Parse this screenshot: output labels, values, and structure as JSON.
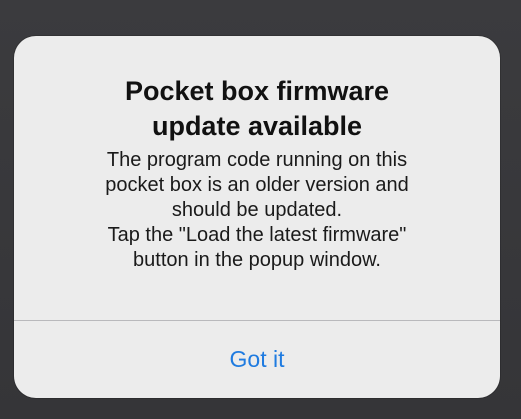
{
  "alert": {
    "title_line1": "Pocket box firmware",
    "title_line2": "update available",
    "message_lines": [
      "The program code running on this",
      "pocket box is an older version and",
      "should be updated.",
      "Tap the \"Load the latest firmware\"",
      "button in the popup window."
    ],
    "action_label": "Got it"
  },
  "colors": {
    "backdrop": "#3a3a3c",
    "alert_background": "#ececec",
    "title_text": "#111111",
    "message_text": "#1a1a1a",
    "action_text": "#1f7be0",
    "divider": "#b9b9bc"
  }
}
